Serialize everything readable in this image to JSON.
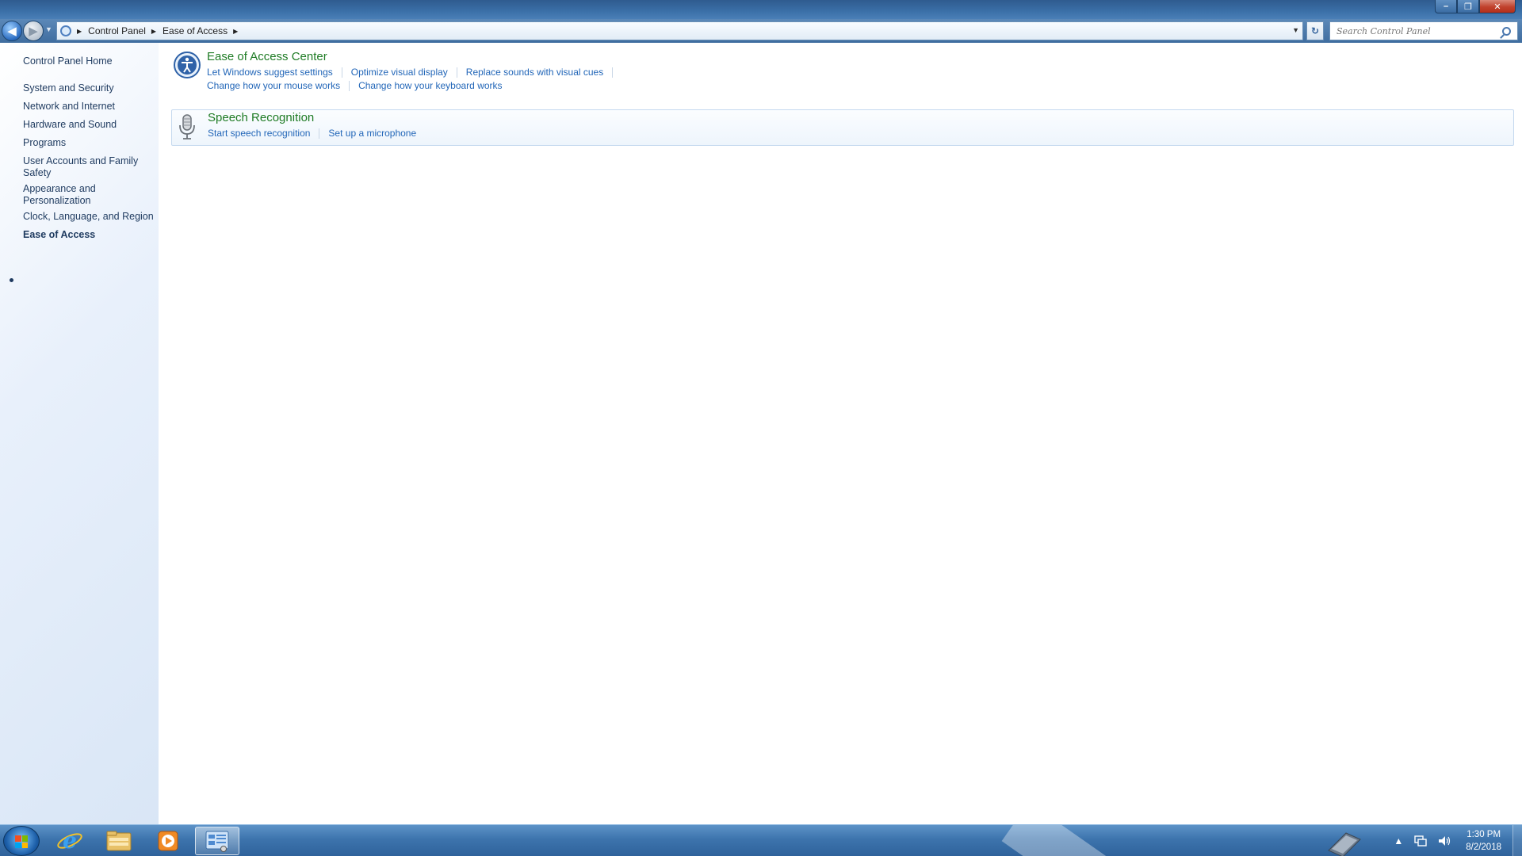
{
  "window": {
    "minimize_glyph": "–",
    "restore_glyph": "❐",
    "close_glyph": "✕"
  },
  "navigation": {
    "back_glyph": "◀",
    "forward_glyph": "▶",
    "recent_glyph": "▼",
    "refresh_glyph": "↻",
    "breadcrumb": [
      "Control Panel",
      "Ease of Access"
    ]
  },
  "search": {
    "placeholder": "Search Control Panel",
    "value": ""
  },
  "sidebar": {
    "home": "Control Panel Home",
    "items": [
      {
        "label": "System and Security"
      },
      {
        "label": "Network and Internet"
      },
      {
        "label": "Hardware and Sound"
      },
      {
        "label": "Programs"
      },
      {
        "label": "User Accounts and Family Safety"
      },
      {
        "label": "Appearance and Personalization"
      },
      {
        "label": "Clock, Language, and Region"
      },
      {
        "label": "Ease of Access",
        "current": true
      }
    ]
  },
  "categories": [
    {
      "title": "Ease of Access Center",
      "icon": "ease-of-access-icon",
      "links_row1": [
        "Let Windows suggest settings",
        "Optimize visual display",
        "Replace sounds with visual cues"
      ],
      "links_row2": [
        "Change how your mouse works",
        "Change how your keyboard works"
      ]
    },
    {
      "title": "Speech Recognition",
      "icon": "microphone-icon",
      "links_row1": [
        "Start speech recognition",
        "Set up a microphone"
      ]
    }
  ],
  "taskbar": {
    "apps": [
      "internet-explorer-icon",
      "windows-explorer-icon",
      "media-player-icon",
      "control-panel-icon"
    ],
    "active_app": "control-panel-icon",
    "tray": {
      "show_hidden_glyph": "▲",
      "network_icon": "network-icon",
      "volume_icon": "volume-icon",
      "time": "1:30 PM",
      "date": "8/2/2018"
    }
  },
  "colors": {
    "category_title": "#1e7b24",
    "link": "#2266b8",
    "sidebar_text": "#1e3a5f",
    "titlebar": "#3b70a8",
    "taskbar": "#3d74ad"
  }
}
